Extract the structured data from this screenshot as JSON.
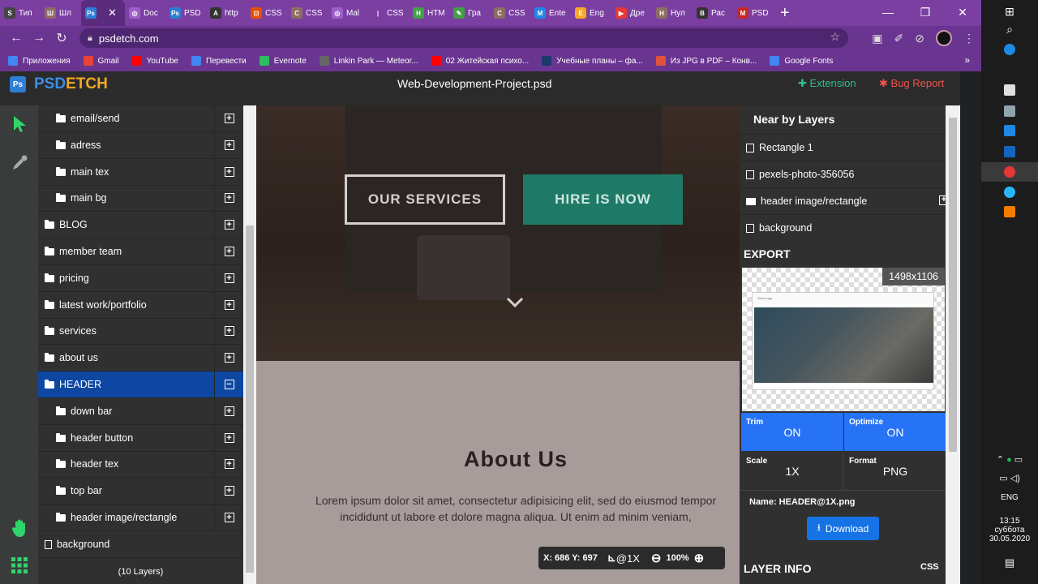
{
  "browser": {
    "tabs": [
      {
        "label": "Тип",
        "color": "#444444",
        "glyph": "S"
      },
      {
        "label": "Шл",
        "color": "#8d6e63",
        "glyph": "Ш"
      },
      {
        "label": "",
        "color": "#2d7fd6",
        "glyph": "Ps",
        "active": true
      },
      {
        "label": "Doc",
        "color": "#9c5ecb",
        "glyph": "◎"
      },
      {
        "label": "PSD",
        "color": "#2d7fd6",
        "glyph": "Ps"
      },
      {
        "label": "http",
        "color": "#333333",
        "glyph": "A"
      },
      {
        "label": "CSS",
        "color": "#e65100",
        "glyph": "⊡"
      },
      {
        "label": "CSS",
        "color": "#8d6e63",
        "glyph": "C"
      },
      {
        "label": "Mal",
        "color": "#9c5ecb",
        "glyph": "◎"
      },
      {
        "label": "CSS",
        "color": "#7b3fa2",
        "glyph": "|"
      },
      {
        "label": "HTM",
        "color": "#43a047",
        "glyph": "H"
      },
      {
        "label": "Гра",
        "color": "#43a047",
        "glyph": "✎"
      },
      {
        "label": "CSS",
        "color": "#8d6e63",
        "glyph": "C"
      },
      {
        "label": "Ente",
        "color": "#1e88e5",
        "glyph": "M"
      },
      {
        "label": "Eng",
        "color": "#f9a825",
        "glyph": "E"
      },
      {
        "label": "Дре",
        "color": "#e53935",
        "glyph": "▶"
      },
      {
        "label": "Нул",
        "color": "#8d6e63",
        "glyph": "Н"
      },
      {
        "label": "Рас",
        "color": "#333333",
        "glyph": "B"
      },
      {
        "label": "PSD",
        "color": "#c62828",
        "glyph": "M"
      }
    ],
    "active_tab_close": "✕",
    "new_tab": "+",
    "url": "psdetch.com",
    "bookmarks": [
      {
        "label": "Приложения",
        "color": "#4285f4"
      },
      {
        "label": "Gmail",
        "color": "#ea4335"
      },
      {
        "label": "YouTube",
        "color": "#ff0000"
      },
      {
        "label": "Перевести",
        "color": "#4285f4"
      },
      {
        "label": "Evernote",
        "color": "#2dbe60"
      },
      {
        "label": "Linkin Park — Meteor...",
        "color": "#666666"
      },
      {
        "label": "02 Житейская психо...",
        "color": "#ff0000"
      },
      {
        "label": "Учебные планы – фа...",
        "color": "#1a3a6b"
      },
      {
        "label": "Из JPG в PDF – Конв...",
        "color": "#e0533a"
      },
      {
        "label": "Google Fonts",
        "color": "#4285f4"
      }
    ],
    "bookmarks_more": "»"
  },
  "app": {
    "logo_a": "PSD",
    "logo_b": "ETCH",
    "logo_badge": "Ps",
    "document_title": "Web-Development-Project.psd",
    "extension_label": "Extension",
    "bug_report_label": "Bug Report"
  },
  "layers": {
    "items": [
      {
        "label": "email/send",
        "indent": 1,
        "type": "folder",
        "toggle": "+"
      },
      {
        "label": "adress",
        "indent": 1,
        "type": "folder",
        "toggle": "+"
      },
      {
        "label": "main tex",
        "indent": 1,
        "type": "folder",
        "toggle": "+"
      },
      {
        "label": "main bg",
        "indent": 1,
        "type": "folder",
        "toggle": "+"
      },
      {
        "label": "BLOG",
        "indent": 0,
        "type": "folder",
        "toggle": "+"
      },
      {
        "label": "member team",
        "indent": 0,
        "type": "folder",
        "toggle": "+"
      },
      {
        "label": "pricing",
        "indent": 0,
        "type": "folder",
        "toggle": "+"
      },
      {
        "label": "latest work/portfolio",
        "indent": 0,
        "type": "folder",
        "toggle": "+"
      },
      {
        "label": "services",
        "indent": 0,
        "type": "folder",
        "toggle": "+"
      },
      {
        "label": "about us",
        "indent": 0,
        "type": "folder",
        "toggle": "+"
      },
      {
        "label": "HEADER",
        "indent": 0,
        "type": "folder",
        "toggle": "−",
        "selected": true
      },
      {
        "label": "down bar",
        "indent": 1,
        "type": "folder",
        "toggle": "+"
      },
      {
        "label": "header button",
        "indent": 1,
        "type": "folder",
        "toggle": "+"
      },
      {
        "label": "header tex",
        "indent": 1,
        "type": "folder",
        "toggle": "+"
      },
      {
        "label": "top bar",
        "indent": 1,
        "type": "folder",
        "toggle": "+"
      },
      {
        "label": "header image/rectangle",
        "indent": 1,
        "type": "folder",
        "toggle": "+"
      },
      {
        "label": "background",
        "indent": 0,
        "type": "file",
        "toggle": ""
      }
    ],
    "count_label": "(10 Layers)"
  },
  "canvas": {
    "btn_services": "OUR SERVICES",
    "btn_hire": "HIRE IS NOW",
    "about_title": "About Us",
    "about_line1": "Lorem ipsum dolor sit amet, consectetur adipisicing elit, sed do eiusmod tempor",
    "about_line2": "incididunt ut labore et dolore magna aliqua. Ut enim ad minim veniam,",
    "coords": "X: 686  Y: 697",
    "scale": "@1X",
    "zoom": "100%"
  },
  "panel": {
    "near_title": "Near by Layers",
    "near_items": [
      {
        "label": "Rectangle 1",
        "type": "shape"
      },
      {
        "label": "pexels-photo-356056",
        "type": "file"
      },
      {
        "label": "header image/rectangle",
        "type": "folder",
        "plus": "+"
      },
      {
        "label": "background",
        "type": "file"
      }
    ],
    "export_title": "EXPORT",
    "preview_dims": "1498x1106",
    "preview_logo": "Your Logo",
    "trim_label": "Trim",
    "trim_value": "ON",
    "optimize_label": "Optimize",
    "optimize_value": "ON",
    "scale_label": "Scale",
    "scale_value": "1X",
    "format_label": "Format",
    "format_value": "PNG",
    "filename": "Name: HEADER@1X.png",
    "download": "Download",
    "layer_info": "LAYER INFO",
    "css": "CSS"
  },
  "taskbar": {
    "lang": "ENG",
    "time": "13:15",
    "day": "суббота",
    "date": "30.05.2020"
  }
}
